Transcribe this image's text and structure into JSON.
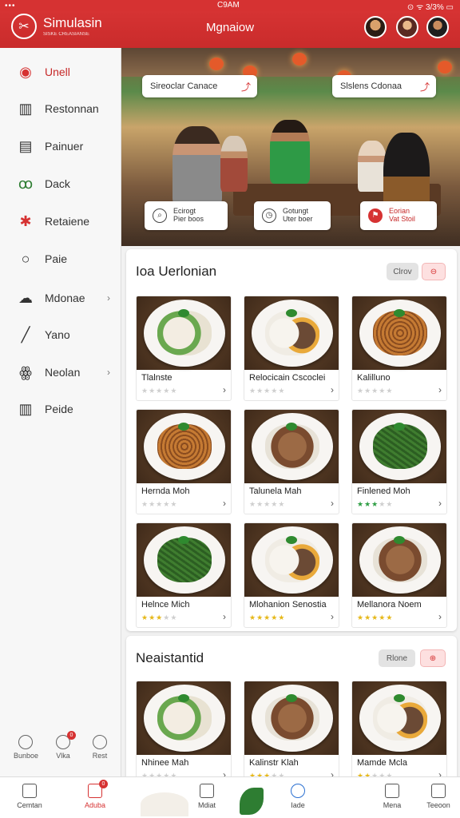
{
  "status": {
    "dots": "•••",
    "time": "C9AM",
    "right": "⊙ ᯤ 3/3% ▭"
  },
  "appbar": {
    "brand": "Simulasin",
    "brand_sub": "SISKE CREASIANSE",
    "title": "Mgnaiow"
  },
  "sidebar": {
    "items": [
      {
        "label": "Unell",
        "icon": "user-circle-icon",
        "glyph": "◉",
        "active": true
      },
      {
        "label": "Restonnan",
        "icon": "building-icon",
        "glyph": "▥"
      },
      {
        "label": "Painuer",
        "icon": "document-icon",
        "glyph": "▤"
      },
      {
        "label": "Dack",
        "icon": "bicycle-icon",
        "glyph": "ꝏ"
      },
      {
        "label": "Retaiene",
        "icon": "star-icon",
        "glyph": "✱"
      },
      {
        "label": "Paie",
        "icon": "circle-icon",
        "glyph": "○"
      },
      {
        "label": "Mdonae",
        "icon": "cloud-icon",
        "glyph": "☁",
        "chevron": "›"
      },
      {
        "label": "Yano",
        "icon": "pencil-icon",
        "glyph": "╱"
      },
      {
        "label": "Neolan",
        "icon": "group-icon",
        "glyph": "ꙮ",
        "chevron": "›"
      },
      {
        "label": "Peide",
        "icon": "building-icon",
        "glyph": "▥"
      }
    ],
    "mini": [
      {
        "label": "Bunboe",
        "icon": "bookmark-icon"
      },
      {
        "label": "Vlka",
        "icon": "clock-icon",
        "badge": "0"
      },
      {
        "label": "Rest",
        "icon": "info-icon"
      }
    ]
  },
  "hero": {
    "chips": [
      {
        "label": "Sireoclar Canace"
      },
      {
        "label": "Slslens Cdonaa"
      }
    ],
    "cards": [
      {
        "line1": "Ecirogt",
        "line2": "Pier boos",
        "icon": "search-icon"
      },
      {
        "line1": "Gotungt",
        "line2": "Uter boer",
        "icon": "clock-icon"
      },
      {
        "line1": "Eorian",
        "line2": "Vat Stoil",
        "icon": "flag-icon"
      }
    ]
  },
  "section1": {
    "title": "Ioa Uerlonian",
    "btn_label": "Clrov",
    "items": [
      {
        "name": "Tlalnste",
        "rating": 0,
        "food": "chicken"
      },
      {
        "name": "Relocicain Cscoclei",
        "rating": 0,
        "food": "rice-meat"
      },
      {
        "name": "Kalilluno",
        "rating": 0,
        "food": "noodle"
      },
      {
        "name": "Hernda Moh",
        "rating": 0,
        "food": "noodle"
      },
      {
        "name": "Talunela Mah",
        "rating": 0,
        "food": "meat"
      },
      {
        "name": "Finlened Moh",
        "rating": 3,
        "star_color": "#2e9e44",
        "food": "beans"
      },
      {
        "name": "Helnce Mich",
        "rating": 3,
        "star_color": "#e6b81a",
        "food": "beans"
      },
      {
        "name": "Mlohanion Senostia",
        "rating": 5,
        "star_color": "#e6b81a",
        "food": "rice-meat"
      },
      {
        "name": "Mellanora Noem",
        "rating": 5,
        "star_color": "#e6b81a",
        "food": "meat"
      }
    ]
  },
  "section2": {
    "title": "Neaistantid",
    "btn_label": "Rlone",
    "items": [
      {
        "name": "Nhinee Mah",
        "rating": 0,
        "food": "chicken"
      },
      {
        "name": "Kalinstr Klah",
        "rating": 3,
        "star_color": "#e6b81a",
        "food": "meat"
      },
      {
        "name": "Mamde Mcla",
        "rating": 2,
        "star_color": "#e6b81a",
        "food": "rice-meat"
      }
    ]
  },
  "bottom_nav": [
    {
      "label": "Cemtan",
      "icon": "home-icon"
    },
    {
      "label": "Aduba",
      "icon": "home-icon",
      "active": true,
      "badge": "0"
    },
    {
      "label": "Mdiat",
      "icon": "home-icon"
    },
    {
      "label": "Iade",
      "icon": "refresh-icon"
    },
    {
      "label": "Mena",
      "icon": "list-icon"
    },
    {
      "label": "Teeoon",
      "icon": "bell-icon"
    }
  ],
  "colors": {
    "brand": "#d63232",
    "star": "#e6b81a",
    "star_green": "#2e9e44"
  }
}
